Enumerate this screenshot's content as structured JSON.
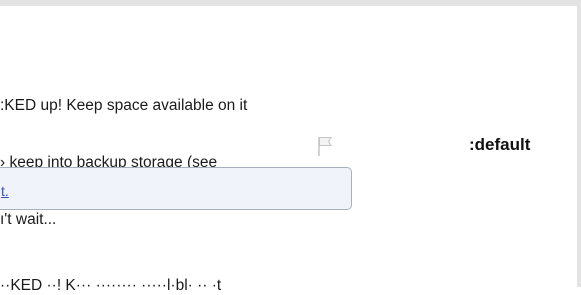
{
  "message": {
    "line1": ":KED up! Keep space available on it",
    "line2": "› keep into backup storage (see",
    "line3": "ı't wait..."
  },
  "status": {
    "flag_icon": "flag-icon",
    "default_label": ":default"
  },
  "url_field": {
    "value": "t."
  },
  "bottom": {
    "text": "··KED ··! K··· ········ ·····l·bl· ·· ·t"
  },
  "colors": {
    "border": "#e3e3e3",
    "field_background": "#f1f3fa",
    "link": "#3a4fa8"
  }
}
